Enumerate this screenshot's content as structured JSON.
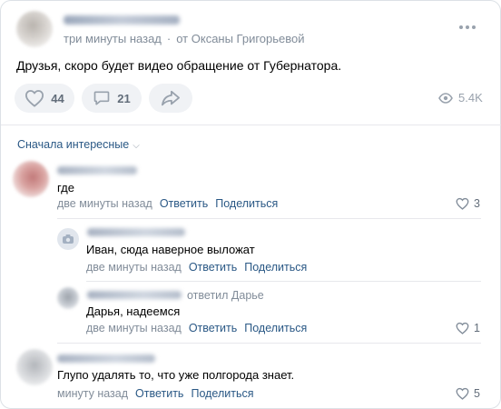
{
  "post": {
    "time": "три минуты назад",
    "from": "от Оксаны Григорьевой",
    "text": "Друзья, скоро будет видео обращение от Губернатора.",
    "likes": "44",
    "comments": "21",
    "views": "5.4K"
  },
  "sort_label": "Сначала интересные",
  "comments": [
    {
      "text": "где",
      "date": "две минуты назад",
      "reply_label": "Ответить",
      "share_label": "Поделиться",
      "likes": "3"
    },
    {
      "text": "Иван, сюда наверное выложат",
      "date": "две минуты назад",
      "reply_label": "Ответить",
      "share_label": "Поделиться"
    },
    {
      "reply_to": "ответил Дарье",
      "text": "Дарья, надеемся",
      "date": "две минуты назад",
      "reply_label": "Ответить",
      "share_label": "Поделиться",
      "likes": "1"
    },
    {
      "text": "Глупо удалять то, что уже полгорода знает.",
      "date": "минуту назад",
      "reply_label": "Ответить",
      "share_label": "Поделиться",
      "likes": "5"
    }
  ],
  "icons": {
    "like": "heart-icon",
    "comment": "comment-bubble-icon",
    "share": "share-arrow-icon",
    "views": "eye-icon",
    "more": "more-dots-icon",
    "sort": "chevron-down-icon",
    "camera": "camera-placeholder-icon"
  },
  "colors": {
    "link": "#2a5885",
    "muted": "#818c99",
    "pill_bg": "#f0f2f5",
    "icon": "#99a2ad"
  }
}
